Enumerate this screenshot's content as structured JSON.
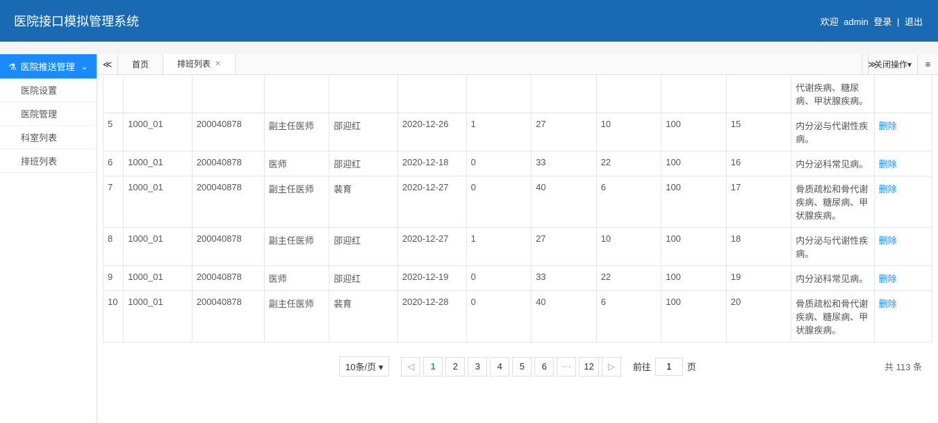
{
  "header": {
    "title": "医院接口模拟管理系统",
    "welcome": "欢迎",
    "username": "admin",
    "login_text": "登录",
    "logout": "退出"
  },
  "sidebar": {
    "group_title": "医院推送管理",
    "items": [
      "医院设置",
      "医院管理",
      "科室列表",
      "排班列表"
    ]
  },
  "tabs": {
    "home": "首页",
    "active": "排班列表",
    "close_ops": "关闭操作"
  },
  "table": {
    "delete_label": "删除",
    "visible_top_row_desc": "代谢疾病、糖尿病、甲状腺疾病。",
    "rows": [
      {
        "idx": "5",
        "c1": "1000_01",
        "c2": "200040878",
        "c3": "副主任医师",
        "c4": "邵迎红",
        "c5": "2020-12-26",
        "c6": "1",
        "c7": "27",
        "c8": "10",
        "c9": "100",
        "c10": "15",
        "c11": "内分泌与代谢性疾病。"
      },
      {
        "idx": "6",
        "c1": "1000_01",
        "c2": "200040878",
        "c3": "医师",
        "c4": "邵迎红",
        "c5": "2020-12-18",
        "c6": "0",
        "c7": "33",
        "c8": "22",
        "c9": "100",
        "c10": "16",
        "c11": "内分泌科常见病。"
      },
      {
        "idx": "7",
        "c1": "1000_01",
        "c2": "200040878",
        "c3": "副主任医师",
        "c4": "裴育",
        "c5": "2020-12-27",
        "c6": "0",
        "c7": "40",
        "c8": "6",
        "c9": "100",
        "c10": "17",
        "c11": "骨质疏松和骨代谢疾病、糖尿病、甲状腺疾病。"
      },
      {
        "idx": "8",
        "c1": "1000_01",
        "c2": "200040878",
        "c3": "副主任医师",
        "c4": "邵迎红",
        "c5": "2020-12-27",
        "c6": "1",
        "c7": "27",
        "c8": "10",
        "c9": "100",
        "c10": "18",
        "c11": "内分泌与代谢性疾病。"
      },
      {
        "idx": "9",
        "c1": "1000_01",
        "c2": "200040878",
        "c3": "医师",
        "c4": "邵迎红",
        "c5": "2020-12-19",
        "c6": "0",
        "c7": "33",
        "c8": "22",
        "c9": "100",
        "c10": "19",
        "c11": "内分泌科常见病。"
      },
      {
        "idx": "10",
        "c1": "1000_01",
        "c2": "200040878",
        "c3": "副主任医师",
        "c4": "裴育",
        "c5": "2020-12-28",
        "c6": "0",
        "c7": "40",
        "c8": "6",
        "c9": "100",
        "c10": "20",
        "c11": "骨质疏松和骨代谢疾病、糖尿病、甲状腺疾病。"
      }
    ]
  },
  "pagination": {
    "page_size": "10条/页",
    "pages": [
      "1",
      "2",
      "3",
      "4",
      "5",
      "6"
    ],
    "last_page": "12",
    "jump_label": "前往",
    "jump_value": "1",
    "jump_unit": "页",
    "total_text": "共 113 条"
  }
}
